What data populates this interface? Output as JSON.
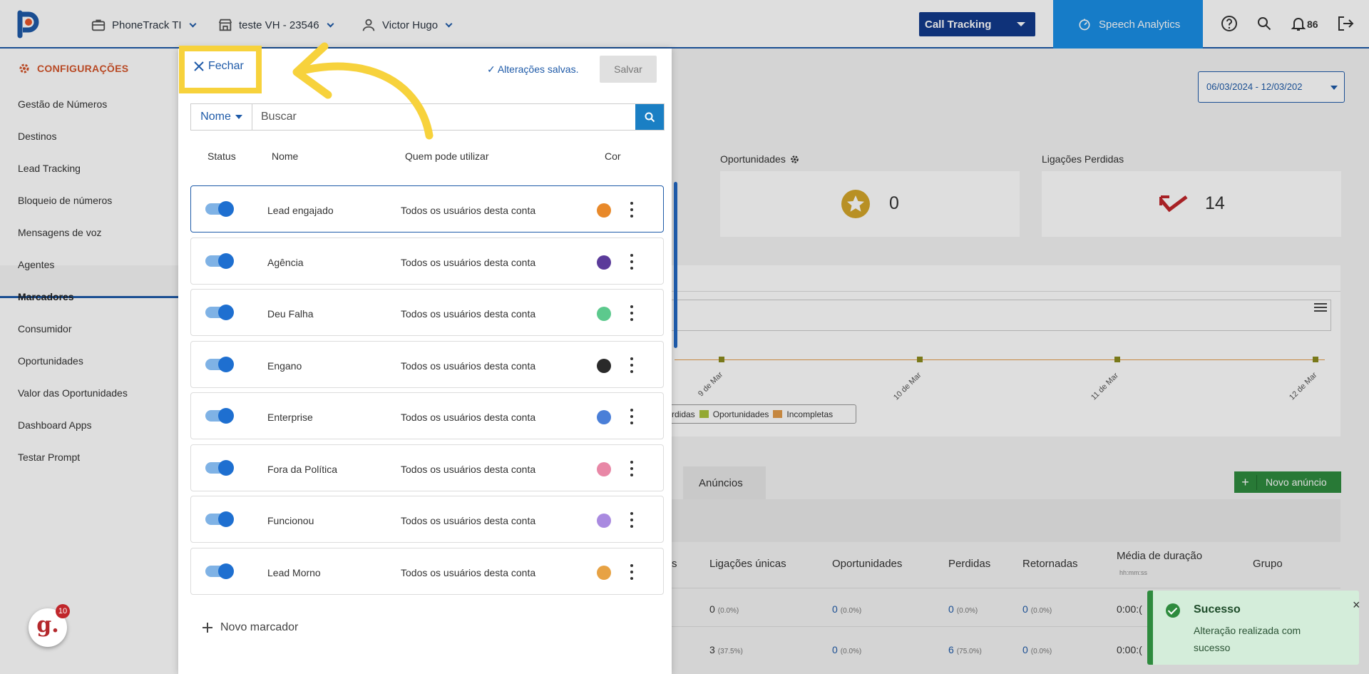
{
  "topbar": {
    "company": "PhoneTrack TI",
    "store": "teste VH - 23546",
    "user": "Victor Hugo",
    "product_select": "Call Tracking",
    "speech_analytics": "Speech Analytics",
    "notifications_count": "86"
  },
  "sidebar": {
    "header": "CONFIGURAÇÕES",
    "items": [
      {
        "label": "Gestão de Números"
      },
      {
        "label": "Destinos"
      },
      {
        "label": "Lead Tracking"
      },
      {
        "label": "Bloqueio de números"
      },
      {
        "label": "Mensagens de voz"
      },
      {
        "label": "Agentes"
      },
      {
        "label": "Marcadores"
      },
      {
        "label": "Consumidor"
      },
      {
        "label": "Oportunidades"
      },
      {
        "label": "Valor das Oportunidades"
      },
      {
        "label": "Dashboard Apps"
      },
      {
        "label": "Testar Prompt"
      }
    ],
    "active_item": "Marcadores"
  },
  "panel": {
    "close_label": "Fechar",
    "saved_label": "✓ Alterações salvas.",
    "save_button": "Salvar",
    "filter_dropdown": "Nome",
    "search_placeholder": "Buscar",
    "columns": {
      "status": "Status",
      "name": "Nome",
      "who": "Quem pode utilizar",
      "color": "Cor"
    },
    "rows": [
      {
        "name": "Lead engajado",
        "who": "Todos os usuários desta conta",
        "color": "#e8892a",
        "enabled": true
      },
      {
        "name": "Agência",
        "who": "Todos os usuários desta conta",
        "color": "#5b3b9a",
        "enabled": true
      },
      {
        "name": "Deu Falha",
        "who": "Todos os usuários desta conta",
        "color": "#5cc98d",
        "enabled": true
      },
      {
        "name": "Engano",
        "who": "Todos os usuários desta conta",
        "color": "#2a2a2a",
        "enabled": true
      },
      {
        "name": "Enterprise",
        "who": "Todos os usuários desta conta",
        "color": "#4a7fd8",
        "enabled": true
      },
      {
        "name": "Fora da Política",
        "who": "Todos os usuários desta conta",
        "color": "#e887a6",
        "enabled": true
      },
      {
        "name": "Funcionou",
        "who": "Todos os usuários desta conta",
        "color": "#a98ae0",
        "enabled": true
      },
      {
        "name": "Lead Morno",
        "who": "Todos os usuários desta conta",
        "color": "#e7a244",
        "enabled": true
      }
    ],
    "add_label": "Novo marcador"
  },
  "dashboard": {
    "date_range": "06/03/2024 - 12/03/202",
    "opportunities_label": "Oportunidades",
    "opportunities_value": "0",
    "lost_calls_label": "Ligações Perdidas",
    "lost_calls_value": "14",
    "chart_dates": [
      "9 de Mar",
      "10 de Mar",
      "11 de Mar",
      "12 de Mar"
    ],
    "legend": [
      {
        "label": "rdidas",
        "color": ""
      },
      {
        "label": "Oportunidades",
        "color": "#a9c23a"
      },
      {
        "label": "Incompletas",
        "color": "#e39b4a"
      }
    ],
    "tab_ads": "Anúncios",
    "new_ad_button": "Novo anúncio",
    "table_headers": [
      "s",
      "Ligações únicas",
      "Oportunidades",
      "Perdidas",
      "Retornadas",
      "Média de duração",
      "Grupo"
    ],
    "duration_sub": "hh:mm:ss",
    "table_rows": [
      {
        "unique": "0",
        "unique_pct": "(0.0%)",
        "opp": "0",
        "opp_pct": "(0.0%)",
        "lost": "0",
        "lost_pct": "(0.0%)",
        "ret": "0",
        "ret_pct": "(0.0%)",
        "dur": "0:00:("
      },
      {
        "unique": "3",
        "unique_pct": "(37.5%)",
        "opp": "0",
        "opp_pct": "(0.0%)",
        "lost": "6",
        "lost_pct": "(75.0%)",
        "ret": "0",
        "ret_pct": "(0.0%)",
        "dur": "0:00:("
      }
    ]
  },
  "toast": {
    "title": "Sucesso",
    "message": "Alteração realizada com sucesso",
    "close": "×"
  },
  "chat_widget": {
    "letter": "g.",
    "badge": "10"
  }
}
